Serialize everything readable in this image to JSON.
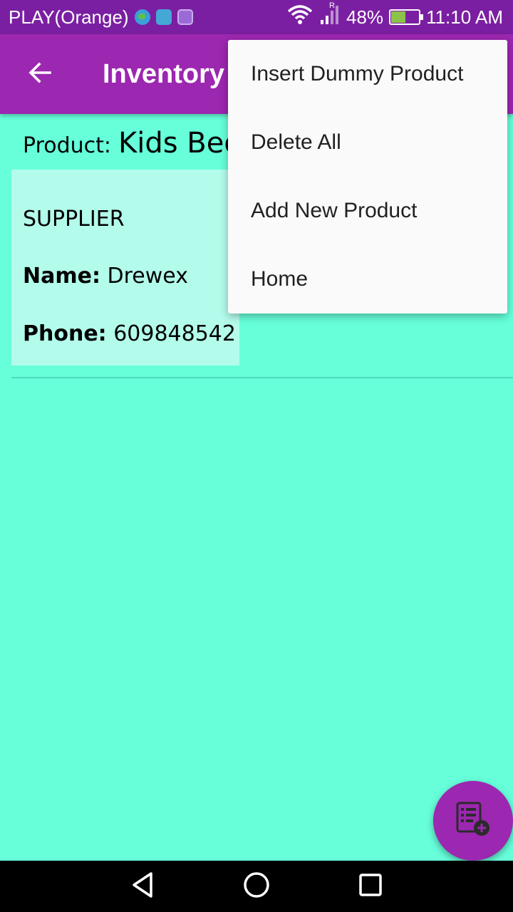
{
  "status_bar": {
    "carrier": "PLAY(Orange)",
    "battery": "48%",
    "time": "11:10 AM",
    "network_indicator": "R"
  },
  "app_bar": {
    "title": "Inventory",
    "back_icon": "arrow-back-icon"
  },
  "product": {
    "label": "Product:",
    "name": "Kids Bed"
  },
  "supplier": {
    "title": "SUPPLIER",
    "name_label": "Name:",
    "name_value": "Drewex",
    "phone_label": "Phone:",
    "phone_value": "609848542"
  },
  "overflow_menu": {
    "items": [
      {
        "label": "Insert Dummy Product"
      },
      {
        "label": "Delete All"
      },
      {
        "label": "Add New Product"
      },
      {
        "label": "Home"
      }
    ]
  },
  "fab": {
    "icon": "add-list-icon"
  },
  "navigation": {
    "back_icon": "nav-back-icon",
    "home_icon": "nav-home-icon",
    "recents_icon": "nav-recents-icon"
  },
  "colors": {
    "status_bar": "#7B1FA2",
    "app_bar": "#9C27B0",
    "background": "#66FFDA",
    "card": "#B3FCEC",
    "menu": "#FAFAFA",
    "fab": "#9C27B0"
  }
}
